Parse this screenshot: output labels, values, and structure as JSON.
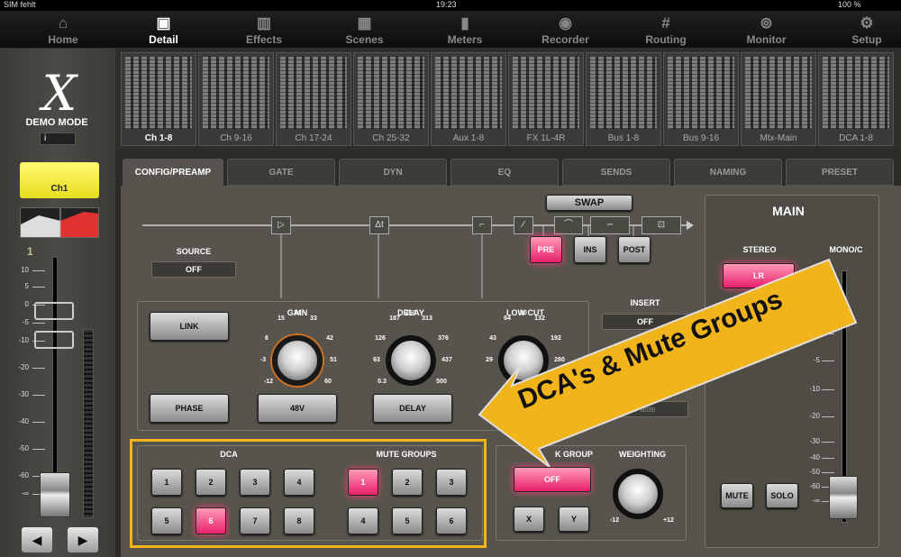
{
  "status": {
    "carrier": "SIM fehlt",
    "time": "19:23",
    "battery": "100 %"
  },
  "nav": [
    {
      "label": "Home",
      "icon": "home-icon"
    },
    {
      "label": "Detail",
      "icon": "detail-icon",
      "active": true
    },
    {
      "label": "Effects",
      "icon": "effects-icon"
    },
    {
      "label": "Scenes",
      "icon": "scenes-icon"
    },
    {
      "label": "Meters",
      "icon": "meters-icon"
    },
    {
      "label": "Recorder",
      "icon": "recorder-icon"
    },
    {
      "label": "Routing",
      "icon": "routing-icon"
    },
    {
      "label": "Monitor",
      "icon": "monitor-icon"
    },
    {
      "label": "Setup",
      "icon": "setup-icon"
    }
  ],
  "left": {
    "logo": "X",
    "mode": "DEMO MODE",
    "info": "i",
    "channel": "Ch1",
    "fader_number": "1",
    "scale": [
      "10",
      "5",
      "0",
      "-5",
      "-10",
      "-20",
      "-30",
      "-40",
      "-50",
      "-60",
      "-∞"
    ],
    "prev": "◀",
    "next": "▶"
  },
  "banks": [
    "Ch 1-8",
    "Ch 9-16",
    "Ch 17-24",
    "Ch 25-32",
    "Aux 1-8",
    "FX 1L-4R",
    "Bus 1-8",
    "Bus 9-16",
    "Mtx-Main",
    "DCA 1-8"
  ],
  "tabs": [
    "CONFIG/PREAMP",
    "GATE",
    "DYN",
    "EQ",
    "SENDS",
    "NAMING",
    "PRESET"
  ],
  "config": {
    "swap": "SWAP",
    "source_label": "SOURCE",
    "source_value": "OFF",
    "pre": "PRE",
    "ins": "INS",
    "post": "POST",
    "insert_label": "INSERT",
    "insert_value": "OFF",
    "paste": "Paste",
    "link": "LINK",
    "phase": "PHASE",
    "v48": "48V",
    "delay_btn": "DELAY",
    "gain": {
      "label": "GAIN",
      "scale": [
        "15",
        "24",
        "33",
        "6",
        "42",
        "-3",
        "51",
        "-12",
        "60"
      ]
    },
    "delay": {
      "label": "DELAY",
      "scale": [
        "187",
        "250",
        "313",
        "126",
        "376",
        "63",
        "437",
        "0.3",
        "500"
      ]
    },
    "lowcut": {
      "label": "LOW CUT",
      "scale": [
        "64",
        "90",
        "132",
        "43",
        "192",
        "29",
        "280"
      ]
    },
    "dca_label": "DCA",
    "dca": [
      "1",
      "2",
      "3",
      "4",
      "5",
      "6",
      "7",
      "8"
    ],
    "mute_label": "MUTE GROUPS",
    "mute": [
      "1",
      "2",
      "3",
      "4",
      "5",
      "6"
    ],
    "group_label": "K GROUP",
    "group_value": "OFF",
    "x": "X",
    "y": "Y",
    "weighting_label": "WEIGHTING",
    "w_min": "-12",
    "w_max": "+12"
  },
  "main": {
    "title": "MAIN",
    "stereo": "STEREO",
    "lr": "LR",
    "mono": "MONO/C",
    "mute": "MUTE",
    "solo": "SOLO",
    "scale": [
      "0",
      "-5",
      "-10",
      "-20",
      "-30",
      "-40",
      "-50",
      "-60",
      "-∞"
    ]
  },
  "callout": {
    "text": "DCA's & Mute Groups",
    "color": "#f1b41b"
  },
  "colors": {
    "accent": "#f1b41b",
    "active_pink": "#e8206a",
    "channel_yellow": "#fffa70"
  }
}
